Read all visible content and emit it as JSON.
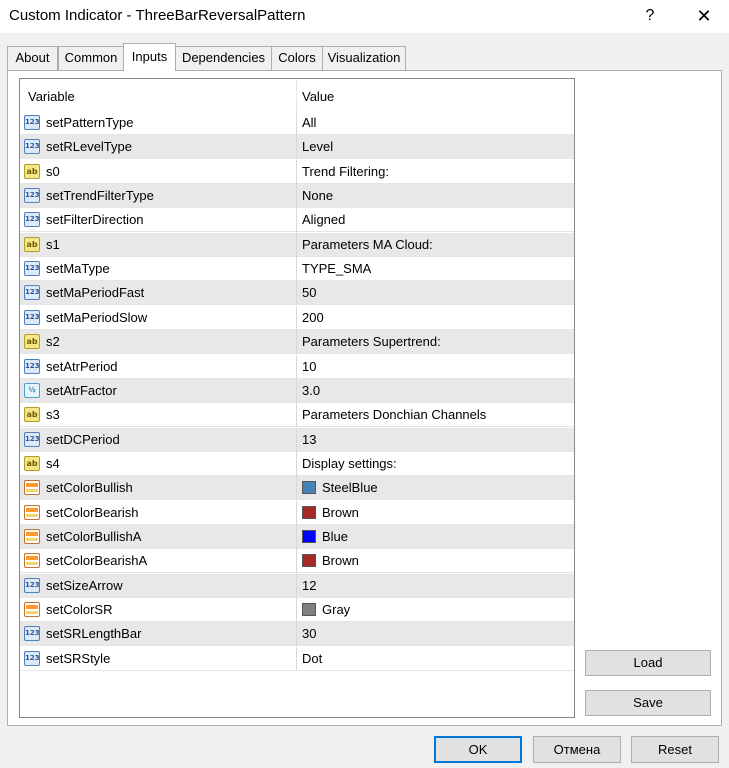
{
  "window": {
    "title": "Custom Indicator - ThreeBarReversalPattern",
    "help": "?",
    "close": "✕"
  },
  "tabs": [
    "About",
    "Common",
    "Inputs",
    "Dependencies",
    "Colors",
    "Visualization"
  ],
  "active_tab": "Inputs",
  "grid": {
    "columns": [
      "Variable",
      "Value"
    ],
    "rows": [
      {
        "type": "int",
        "icon": "integer-icon",
        "name": "setPatternType",
        "value": "All"
      },
      {
        "type": "int",
        "icon": "integer-icon",
        "name": "setRLevelType",
        "value": "Level"
      },
      {
        "type": "str",
        "icon": "string-icon",
        "name": "s0",
        "value": "Trend Filtering:"
      },
      {
        "type": "int",
        "icon": "integer-icon",
        "name": "setTrendFilterType",
        "value": "None"
      },
      {
        "type": "int",
        "icon": "integer-icon",
        "name": "setFilterDirection",
        "value": "Aligned"
      },
      {
        "type": "str",
        "icon": "string-icon",
        "name": "s1",
        "value": "Parameters MA Cloud:"
      },
      {
        "type": "int",
        "icon": "integer-icon",
        "name": "setMaType",
        "value": "TYPE_SMA"
      },
      {
        "type": "int",
        "icon": "integer-icon",
        "name": "setMaPeriodFast",
        "value": "50"
      },
      {
        "type": "int",
        "icon": "integer-icon",
        "name": "setMaPeriodSlow",
        "value": "200"
      },
      {
        "type": "str",
        "icon": "string-icon",
        "name": "s2",
        "value": "Parameters Supertrend:"
      },
      {
        "type": "int",
        "icon": "integer-icon",
        "name": "setAtrPeriod",
        "value": "10"
      },
      {
        "type": "dbl",
        "icon": "double-icon",
        "name": "setAtrFactor",
        "value": "3.0"
      },
      {
        "type": "str",
        "icon": "string-icon",
        "name": "s3",
        "value": "Parameters Donchian Channels"
      },
      {
        "type": "int",
        "icon": "integer-icon",
        "name": "setDCPeriod",
        "value": "13"
      },
      {
        "type": "str",
        "icon": "string-icon",
        "name": "s4",
        "value": "Display settings:"
      },
      {
        "type": "clr",
        "icon": "color-icon",
        "name": "setColorBullish",
        "value": "SteelBlue",
        "swatch": "#4682b4"
      },
      {
        "type": "clr",
        "icon": "color-icon",
        "name": "setColorBearish",
        "value": "Brown",
        "swatch": "#a52a2a"
      },
      {
        "type": "clr",
        "icon": "color-icon",
        "name": "setColorBullishA",
        "value": "Blue",
        "swatch": "#0000ff"
      },
      {
        "type": "clr",
        "icon": "color-icon",
        "name": "setColorBearishA",
        "value": "Brown",
        "swatch": "#a52a2a"
      },
      {
        "type": "int",
        "icon": "integer-icon",
        "name": "setSizeArrow",
        "value": "12"
      },
      {
        "type": "clr",
        "icon": "color-icon",
        "name": "setColorSR",
        "value": "Gray",
        "swatch": "#808080"
      },
      {
        "type": "int",
        "icon": "integer-icon",
        "name": "setSRLengthBar",
        "value": "30"
      },
      {
        "type": "int",
        "icon": "integer-icon",
        "name": "setSRStyle",
        "value": "Dot"
      }
    ]
  },
  "side_buttons": {
    "load": "Load",
    "save": "Save"
  },
  "footer_buttons": {
    "ok": "OK",
    "cancel": "Отмена",
    "reset": "Reset"
  }
}
